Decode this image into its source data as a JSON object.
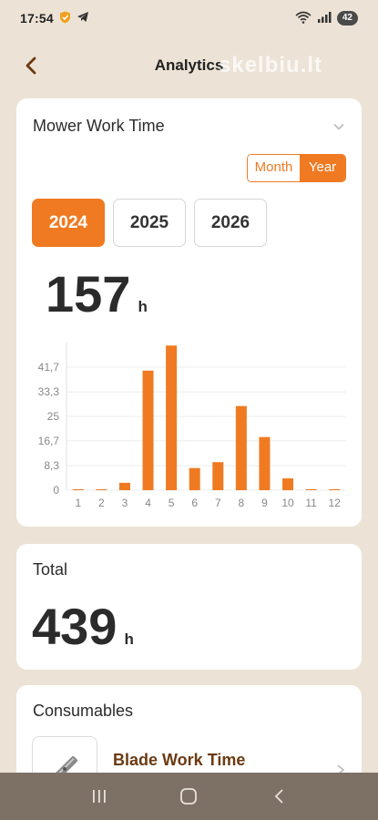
{
  "status_bar": {
    "time": "17:54",
    "battery": "42"
  },
  "header": {
    "title": "Analytics",
    "watermark": "skelbiu.lt"
  },
  "work_time_card": {
    "title": "Mower Work Time",
    "toggle": {
      "month_label": "Month",
      "year_label": "Year",
      "selected": "Year"
    },
    "years": [
      "2024",
      "2025",
      "2026"
    ],
    "selected_year": "2024",
    "value": "157",
    "unit": "h"
  },
  "chart_data": {
    "type": "bar",
    "categories": [
      "1",
      "2",
      "3",
      "4",
      "5",
      "6",
      "7",
      "8",
      "9",
      "10",
      "11",
      "12"
    ],
    "values": [
      0.2,
      0.2,
      2.5,
      40.5,
      49,
      7.5,
      9.5,
      28.5,
      18,
      4,
      0.2,
      0.2
    ],
    "yticks": [
      "0",
      "8,3",
      "16,7",
      "25",
      "33,3",
      "41,7"
    ],
    "ytick_values": [
      0,
      8.3,
      16.7,
      25,
      33.3,
      41.7
    ],
    "ylim": [
      0,
      50
    ],
    "color": "#f07a22",
    "grid": true
  },
  "total_card": {
    "title": "Total",
    "value": "439",
    "unit": "h"
  },
  "consumables_card": {
    "title": "Consumables",
    "item_name": "Blade Work Time"
  },
  "colors": {
    "accent": "#f07a22",
    "background": "#ece3d6",
    "consumable_text": "#6b3a12"
  }
}
